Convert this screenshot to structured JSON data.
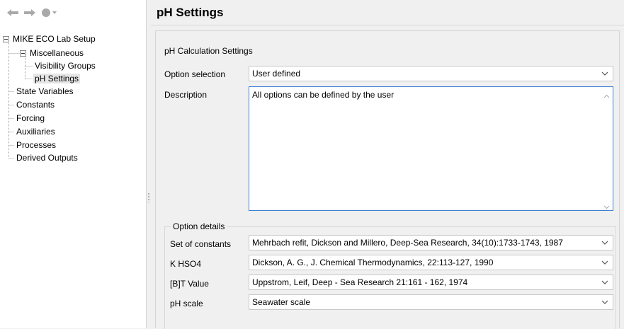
{
  "toolbar": {
    "back_icon": "back-arrow-icon",
    "forward_icon": "forward-arrow-icon",
    "history_icon": "history-dropdown-icon"
  },
  "tree": {
    "root": "MIKE ECO Lab Setup",
    "miscellaneous": "Miscellaneous",
    "visibility_groups": "Visibility Groups",
    "ph_settings": "pH Settings",
    "state_variables": "State Variables",
    "constants": "Constants",
    "forcing": "Forcing",
    "auxiliaries": "Auxiliaries",
    "processes": "Processes",
    "derived_outputs": "Derived Outputs"
  },
  "page": {
    "title": "pH Settings"
  },
  "settings": {
    "section_title": "pH Calculation Settings",
    "option_selection_label": "Option selection",
    "option_selection_value": "User defined",
    "description_label": "Description",
    "description_value": "All options can be defined by the user"
  },
  "option_details": {
    "title": "Option details",
    "set_of_constants_label": "Set of constants",
    "set_of_constants_value": "Mehrbach refit, Dickson and Millero, Deep-Sea Research, 34(10):1733-1743, 1987",
    "khso4_label": "K HSO4",
    "khso4_value": "Dickson, A. G., J. Chemical Thermodynamics, 22:113-127, 1990",
    "bt_value_label": "[B]T Value",
    "bt_value_value": "Uppstrom, Leif, Deep - Sea Research 21:161 - 162, 1974",
    "ph_scale_label": "pH scale",
    "ph_scale_value": "Seawater scale"
  },
  "colors": {
    "accent_border": "#3c7fd4",
    "selected_bg": "#e5e5e5",
    "panel_bg": "#f0f0f0"
  }
}
